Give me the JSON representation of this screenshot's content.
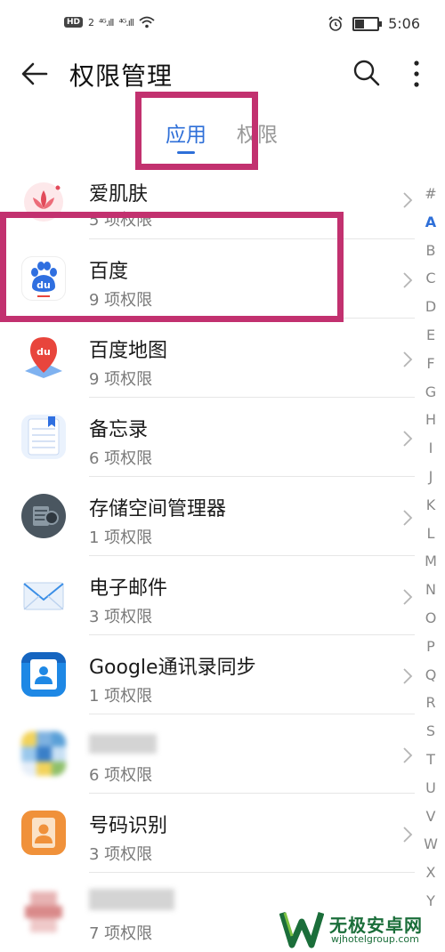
{
  "status_bar": {
    "hd_badge": "HD",
    "hd_sub": "2",
    "signal1": "⁴ᴳ.ıll",
    "signal2": "⁴ᴳ.ıll",
    "time": "5:06"
  },
  "header": {
    "title": "权限管理"
  },
  "tabs": [
    {
      "label": "应用",
      "active": true
    },
    {
      "label": "权限",
      "active": false
    }
  ],
  "apps": [
    {
      "name": "爱肌肤",
      "count": "5 项权限",
      "icon": "lotus-icon",
      "color": "#e24a5a"
    },
    {
      "name": "百度",
      "count": "9 项权限",
      "icon": "baidu-paw-icon",
      "color": "#2f6fe0"
    },
    {
      "name": "百度地图",
      "count": "9 项权限",
      "icon": "baidu-map-icon",
      "color": "#e8453c"
    },
    {
      "name": "备忘录",
      "count": "6 项权限",
      "icon": "notepad-icon",
      "color": "#4d8ff0"
    },
    {
      "name": "存储空间管理器",
      "count": "1 项权限",
      "icon": "storage-icon",
      "color": "#4a5660"
    },
    {
      "name": "电子邮件",
      "count": "3 项权限",
      "icon": "email-icon",
      "color": "#3a8ee6"
    },
    {
      "name": "Google通讯录同步",
      "count": "1 项权限",
      "icon": "contacts-icon",
      "color": "#1e88e5"
    },
    {
      "name": "",
      "count": "6 项权限",
      "icon": "blurred-app-icon",
      "color": "#7fb2e0"
    },
    {
      "name": "号码识别",
      "count": "3 项权限",
      "icon": "caller-id-icon",
      "color": "#f0913a"
    },
    {
      "name": "",
      "count": "7 项权限",
      "icon": "blurred-app-icon-2",
      "color": "#d98a8a"
    }
  ],
  "alphabet": [
    "#",
    "A",
    "B",
    "C",
    "D",
    "E",
    "F",
    "G",
    "H",
    "I",
    "J",
    "K",
    "L",
    "M",
    "N",
    "O",
    "P",
    "Q",
    "R",
    "S",
    "T",
    "U",
    "V",
    "W",
    "X",
    "Y"
  ],
  "alphabet_active": "A",
  "watermark": {
    "text": "无极安卓网",
    "url": "wjhotelgroup.com"
  },
  "colors": {
    "accent": "#2e6fd8",
    "highlight": "#c2316f"
  }
}
